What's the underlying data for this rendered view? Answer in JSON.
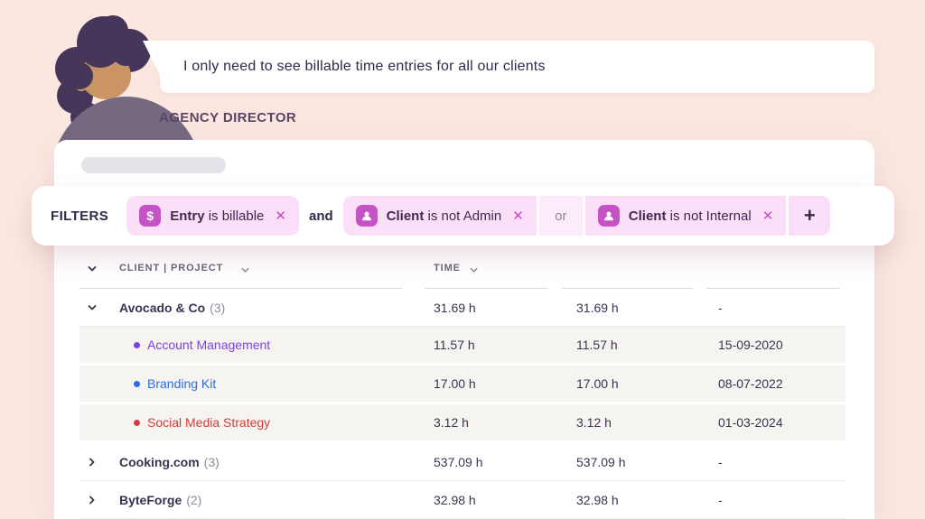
{
  "persona": {
    "name": "AGENCY DIRECTOR",
    "speech": "I only need to see billable time entries for all our clients"
  },
  "filters": {
    "label": "FILTERS",
    "chip1": {
      "icon": "dollar-icon",
      "subject": "Entry",
      "condition": "is billable",
      "close": "✕"
    },
    "and_connector": "and",
    "chip2": {
      "icon": "person-icon",
      "subject": "Client",
      "condition": "is not Admin",
      "close": "✕"
    },
    "or_connector": "or",
    "chip3": {
      "icon": "person-icon",
      "subject": "Client",
      "condition": "is not Internal",
      "close": "✕"
    },
    "add_button": "+"
  },
  "table": {
    "headers": {
      "client_project": "CLIENT | PROJECT",
      "time": "TIME"
    },
    "rows": [
      {
        "type": "client",
        "expanded": "true",
        "name": "Avocado & Co",
        "count": "(3)",
        "time": "31.69 h",
        "billable_time": "31.69 h",
        "last_date": "-"
      },
      {
        "type": "project",
        "name": "Account Management",
        "time": "11.57 h",
        "billable_time": "11.57 h",
        "last_date": "15-09-2020",
        "color": "#7e41e2"
      },
      {
        "type": "project",
        "name": "Branding Kit",
        "time": "17.00 h",
        "billable_time": "17.00 h",
        "last_date": "08-07-2022",
        "color": "#2d6be4"
      },
      {
        "type": "project",
        "name": "Social Media Strategy",
        "time": "3.12 h",
        "billable_time": "3.12 h",
        "last_date": "01-03-2024",
        "color": "#d23d3a"
      },
      {
        "type": "client",
        "expanded": "false",
        "name": "Cooking.com",
        "count": "(3)",
        "time": "537.09 h",
        "billable_time": "537.09 h",
        "last_date": "-"
      },
      {
        "type": "client",
        "expanded": "false",
        "name": "ByteForge",
        "count": "(2)",
        "time": "32.98 h",
        "billable_time": "32.98 h",
        "last_date": "-"
      }
    ]
  },
  "colors": {
    "background_peach": "#fbe7e0",
    "chip_pink": "#fbdef8",
    "chip_or_pink": "#fcecfa",
    "filter_icon_magenta": "#c553c6",
    "close_x_magenta": "#c44fc4",
    "text_dark_purple": "#32284a",
    "project_purple": "#7e41e2",
    "project_blue": "#2d6be4",
    "project_red": "#d23d3a"
  }
}
